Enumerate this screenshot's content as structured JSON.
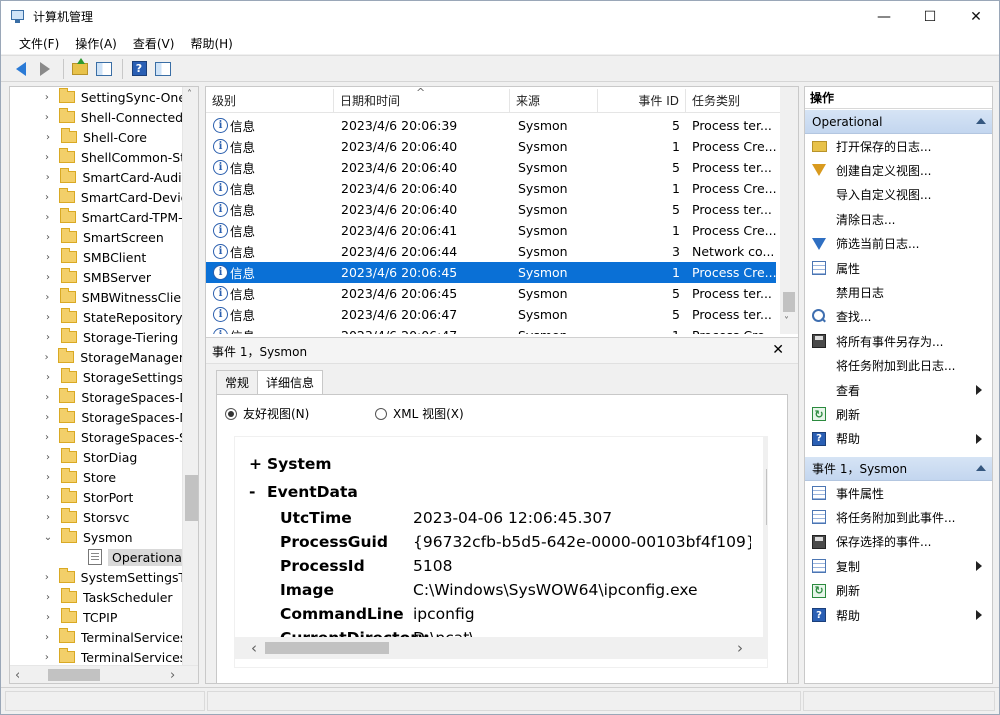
{
  "window": {
    "title": "计算机管理",
    "controls": {
      "minimize": "—",
      "maximize": "☐",
      "close": "✕"
    }
  },
  "menu": [
    {
      "label": "文件(F)"
    },
    {
      "label": "操作(A)"
    },
    {
      "label": "查看(V)"
    },
    {
      "label": "帮助(H)"
    }
  ],
  "toolbar": {
    "icons": [
      "back-arrow-icon",
      "forward-arrow-icon",
      "folder-up-icon",
      "show-pane-icon",
      "help-icon",
      "console-pane-icon"
    ],
    "help_glyph": "?"
  },
  "tree": {
    "items": [
      {
        "label": "SettingSync-OneDri",
        "chevron": "›"
      },
      {
        "label": "Shell-ConnectedAcc",
        "chevron": "›"
      },
      {
        "label": "Shell-Core",
        "chevron": "›"
      },
      {
        "label": "ShellCommon-Start",
        "chevron": "›"
      },
      {
        "label": "SmartCard-Audit",
        "chevron": "›"
      },
      {
        "label": "SmartCard-DeviceE",
        "chevron": "›"
      },
      {
        "label": "SmartCard-TPM-Vi",
        "chevron": "›"
      },
      {
        "label": "SmartScreen",
        "chevron": "›"
      },
      {
        "label": "SMBClient",
        "chevron": "›"
      },
      {
        "label": "SMBServer",
        "chevron": "›"
      },
      {
        "label": "SMBWitnessClient",
        "chevron": "›"
      },
      {
        "label": "StateRepository",
        "chevron": "›"
      },
      {
        "label": "Storage-Tiering",
        "chevron": "›"
      },
      {
        "label": "StorageManagement",
        "chevron": "›"
      },
      {
        "label": "StorageSettings",
        "chevron": "›"
      },
      {
        "label": "StorageSpaces-Dri",
        "chevron": "›"
      },
      {
        "label": "StorageSpaces-Ma",
        "chevron": "›"
      },
      {
        "label": "StorageSpaces-Spa",
        "chevron": "›"
      },
      {
        "label": "StorDiag",
        "chevron": "›"
      },
      {
        "label": "Store",
        "chevron": "›"
      },
      {
        "label": "StorPort",
        "chevron": "›"
      },
      {
        "label": "Storsvc",
        "chevron": "›"
      },
      {
        "label": "Sysmon",
        "chevron": "⌄"
      },
      {
        "label": "Operational",
        "chevron": ""
      },
      {
        "label": "SystemSettingsThre",
        "chevron": "›"
      },
      {
        "label": "TaskScheduler",
        "chevron": "›"
      },
      {
        "label": "TCPIP",
        "chevron": "›"
      },
      {
        "label": "TerminalServices-Cl",
        "chevron": "›"
      },
      {
        "label": "TerminalServices-Lo",
        "chevron": "›"
      }
    ],
    "scroll": {
      "up": "˄",
      "down": "˅",
      "left": "‹",
      "right": "›"
    }
  },
  "events": {
    "columns": [
      "级别",
      "日期和时间",
      "来源",
      "事件 ID",
      "任务类别"
    ],
    "sort_indicator": "^",
    "rows": [
      {
        "level": "信息",
        "datetime": "2023/4/6 20:06:39",
        "source": "Sysmon",
        "id": "5",
        "task": "Process ter..."
      },
      {
        "level": "信息",
        "datetime": "2023/4/6 20:06:40",
        "source": "Sysmon",
        "id": "1",
        "task": "Process Cre..."
      },
      {
        "level": "信息",
        "datetime": "2023/4/6 20:06:40",
        "source": "Sysmon",
        "id": "5",
        "task": "Process ter..."
      },
      {
        "level": "信息",
        "datetime": "2023/4/6 20:06:40",
        "source": "Sysmon",
        "id": "1",
        "task": "Process Cre..."
      },
      {
        "level": "信息",
        "datetime": "2023/4/6 20:06:40",
        "source": "Sysmon",
        "id": "5",
        "task": "Process ter..."
      },
      {
        "level": "信息",
        "datetime": "2023/4/6 20:06:41",
        "source": "Sysmon",
        "id": "1",
        "task": "Process Cre..."
      },
      {
        "level": "信息",
        "datetime": "2023/4/6 20:06:44",
        "source": "Sysmon",
        "id": "3",
        "task": "Network co..."
      },
      {
        "level": "信息",
        "datetime": "2023/4/6 20:06:45",
        "source": "Sysmon",
        "id": "1",
        "task": "Process Cre...",
        "selected": true
      },
      {
        "level": "信息",
        "datetime": "2023/4/6 20:06:45",
        "source": "Sysmon",
        "id": "5",
        "task": "Process ter..."
      },
      {
        "level": "信息",
        "datetime": "2023/4/6 20:06:47",
        "source": "Sysmon",
        "id": "5",
        "task": "Process ter..."
      },
      {
        "level": "信息",
        "datetime": "2023/4/6 20:06:47",
        "source": "Sysmon",
        "id": "1",
        "task": "Process Cre..."
      }
    ],
    "info_glyph": "i"
  },
  "detail": {
    "title": "事件 1，Sysmon",
    "close": "✕",
    "tabs": [
      "常规",
      "详细信息"
    ],
    "active_tab": 1,
    "radio_friendly": "友好视图(N)",
    "radio_xml": "XML 视图(X)",
    "sections": {
      "system": {
        "sign": "+",
        "label": "System"
      },
      "eventdata": {
        "sign": "-",
        "label": "EventData"
      }
    },
    "fields": [
      {
        "key": "UtcTime",
        "value": "2023-04-06 12:06:45.307"
      },
      {
        "key": "ProcessGuid",
        "value": "{96732cfb-b5d5-642e-0000-00103bf4f109}"
      },
      {
        "key": "ProcessId",
        "value": "5108"
      },
      {
        "key": "Image",
        "value": "C:\\Windows\\SysWOW64\\ipconfig.exe"
      },
      {
        "key": "CommandLine",
        "value": "ipconfig"
      },
      {
        "key": "CurrentDirectory",
        "value": "D:\\ncat\\"
      }
    ],
    "scroll": {
      "up": "˄",
      "down": "˅",
      "left": "‹",
      "right": "›"
    }
  },
  "actions": {
    "header": "操作",
    "section1": "Operational",
    "items1": [
      {
        "label": "打开保存的日志...",
        "icon": "open-folder-icon",
        "arrow": false
      },
      {
        "label": "创建自定义视图...",
        "icon": "create-filter-icon",
        "arrow": false
      },
      {
        "label": "导入自定义视图...",
        "icon": "",
        "arrow": false
      },
      {
        "label": "清除日志...",
        "icon": "",
        "arrow": false
      },
      {
        "label": "筛选当前日志...",
        "icon": "filter-icon",
        "arrow": false
      },
      {
        "label": "属性",
        "icon": "properties-icon",
        "arrow": false
      },
      {
        "label": "禁用日志",
        "icon": "",
        "arrow": false
      },
      {
        "label": "查找...",
        "icon": "find-icon",
        "arrow": false
      },
      {
        "label": "将所有事件另存为...",
        "icon": "save-icon",
        "arrow": false
      },
      {
        "label": "将任务附加到此日志...",
        "icon": "",
        "arrow": false
      },
      {
        "label": "查看",
        "icon": "",
        "arrow": true
      },
      {
        "label": "刷新",
        "icon": "refresh-icon",
        "arrow": false
      },
      {
        "label": "帮助",
        "icon": "help-icon",
        "arrow": true
      }
    ],
    "section2": "事件 1，Sysmon",
    "items2": [
      {
        "label": "事件属性",
        "icon": "properties-icon",
        "arrow": false
      },
      {
        "label": "将任务附加到此事件...",
        "icon": "task-icon",
        "arrow": false
      },
      {
        "label": "保存选择的事件...",
        "icon": "save-icon",
        "arrow": false
      },
      {
        "label": "复制",
        "icon": "copy-icon",
        "arrow": true
      },
      {
        "label": "刷新",
        "icon": "refresh-icon",
        "arrow": false
      },
      {
        "label": "帮助",
        "icon": "help-icon",
        "arrow": true
      }
    ],
    "refresh_glyph": "↻",
    "help_glyph": "?"
  },
  "colors": {
    "selection": "#0a70d6",
    "section_header": "#c3d6ef",
    "folder": "#f3cf69"
  }
}
